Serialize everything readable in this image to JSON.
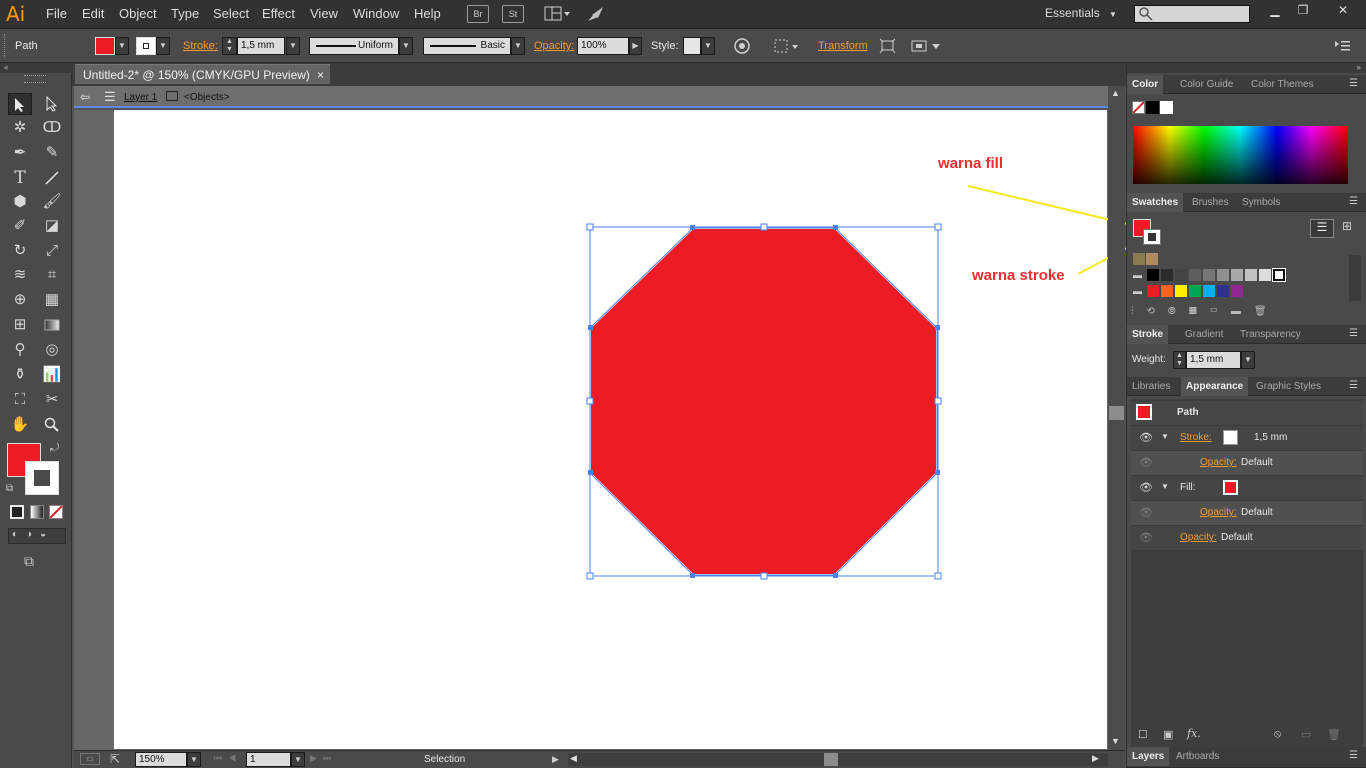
{
  "app": {
    "logo": "Ai"
  },
  "menu": [
    "File",
    "Edit",
    "Object",
    "Type",
    "Select",
    "Effect",
    "View",
    "Window",
    "Help"
  ],
  "menubar_icons": {
    "br": "Br",
    "st": "St"
  },
  "workspace": "Essentials",
  "window_buttons": {
    "minimize": "▁",
    "restore": "❐",
    "close": "✕"
  },
  "control": {
    "selection": "Path",
    "stroke_label": "Stroke:",
    "stroke_weight": "1,5 mm",
    "profile": "Uniform",
    "brush": "Basic",
    "opacity_label": "Opacity:",
    "opacity_value": "100%",
    "style_label": "Style:",
    "transform": "Transform",
    "fill_color": "#ed1c24"
  },
  "document": {
    "tab_title": "Untitled-2* @ 150% (CMYK/GPU Preview)",
    "tab_close": "×",
    "layer": "Layer 1",
    "objects": "<Objects>",
    "shape_color": "#ed1c24",
    "selection_color": "#4a80f0"
  },
  "annotations": {
    "fill": "warna fill",
    "stroke": "warna stroke"
  },
  "panels": {
    "color_tabs": [
      "Color",
      "Color Guide",
      "Color Themes"
    ],
    "swatch_tabs": [
      "Swatches",
      "Brushes",
      "Symbols"
    ],
    "stroke_tabs": [
      "Stroke",
      "Gradient",
      "Transparency"
    ],
    "weight_label": "Weight:",
    "weight_value": "1,5 mm",
    "appearance_tabs": [
      "Libraries",
      "Appearance",
      "Graphic Styles"
    ],
    "appearance": {
      "title": "Path",
      "stroke_label": "Stroke:",
      "stroke_value": "1,5 mm",
      "opacity_label": "Opacity:",
      "opacity_value": "Default",
      "fill_label": "Fill:",
      "opacity2_label": "Opacity:",
      "opacity2_value": "Default",
      "opacity3_label": "Opacity:",
      "opacity3_value": "Default",
      "fx": "fx."
    },
    "bottom_tabs": [
      "Layers",
      "Artboards"
    ]
  },
  "status": {
    "zoom": "150%",
    "artboard": "1",
    "mode": "Selection"
  },
  "swatch_colors": {
    "row1": [
      "#000000",
      "#2b2b2b",
      "#444444",
      "#5e5e5e",
      "#777777",
      "#909090",
      "#a9a9a9",
      "#c2c2c2",
      "#dcdcdc",
      "#ffffff"
    ],
    "row2": [
      "#ed1c24",
      "#f26522",
      "#fff200",
      "#00a651",
      "#00aeef",
      "#2e3192",
      "#92278f"
    ]
  }
}
